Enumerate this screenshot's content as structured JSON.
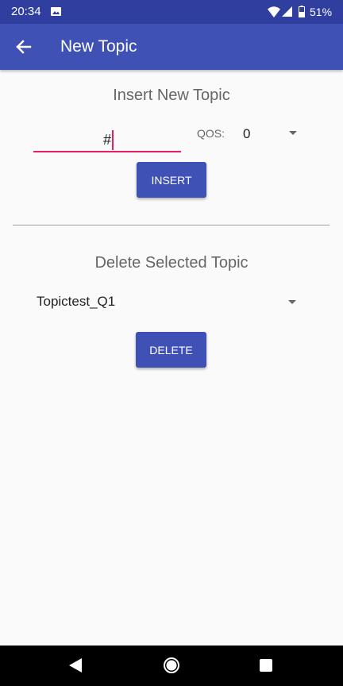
{
  "status_bar": {
    "time": "20:34",
    "battery": "51%"
  },
  "app_bar": {
    "title": "New Topic"
  },
  "insert_section": {
    "title": "Insert New Topic",
    "topic_value": "#",
    "qos_label": "QOS:",
    "qos_value": "0",
    "button_label": "INSERT"
  },
  "delete_section": {
    "title": "Delete Selected Topic",
    "selected_topic": "Topictest_Q1",
    "button_label": "DELETE"
  },
  "colors": {
    "primary": "#3f51b5",
    "primary_dark": "#303f9f",
    "accent": "#e91e63"
  }
}
